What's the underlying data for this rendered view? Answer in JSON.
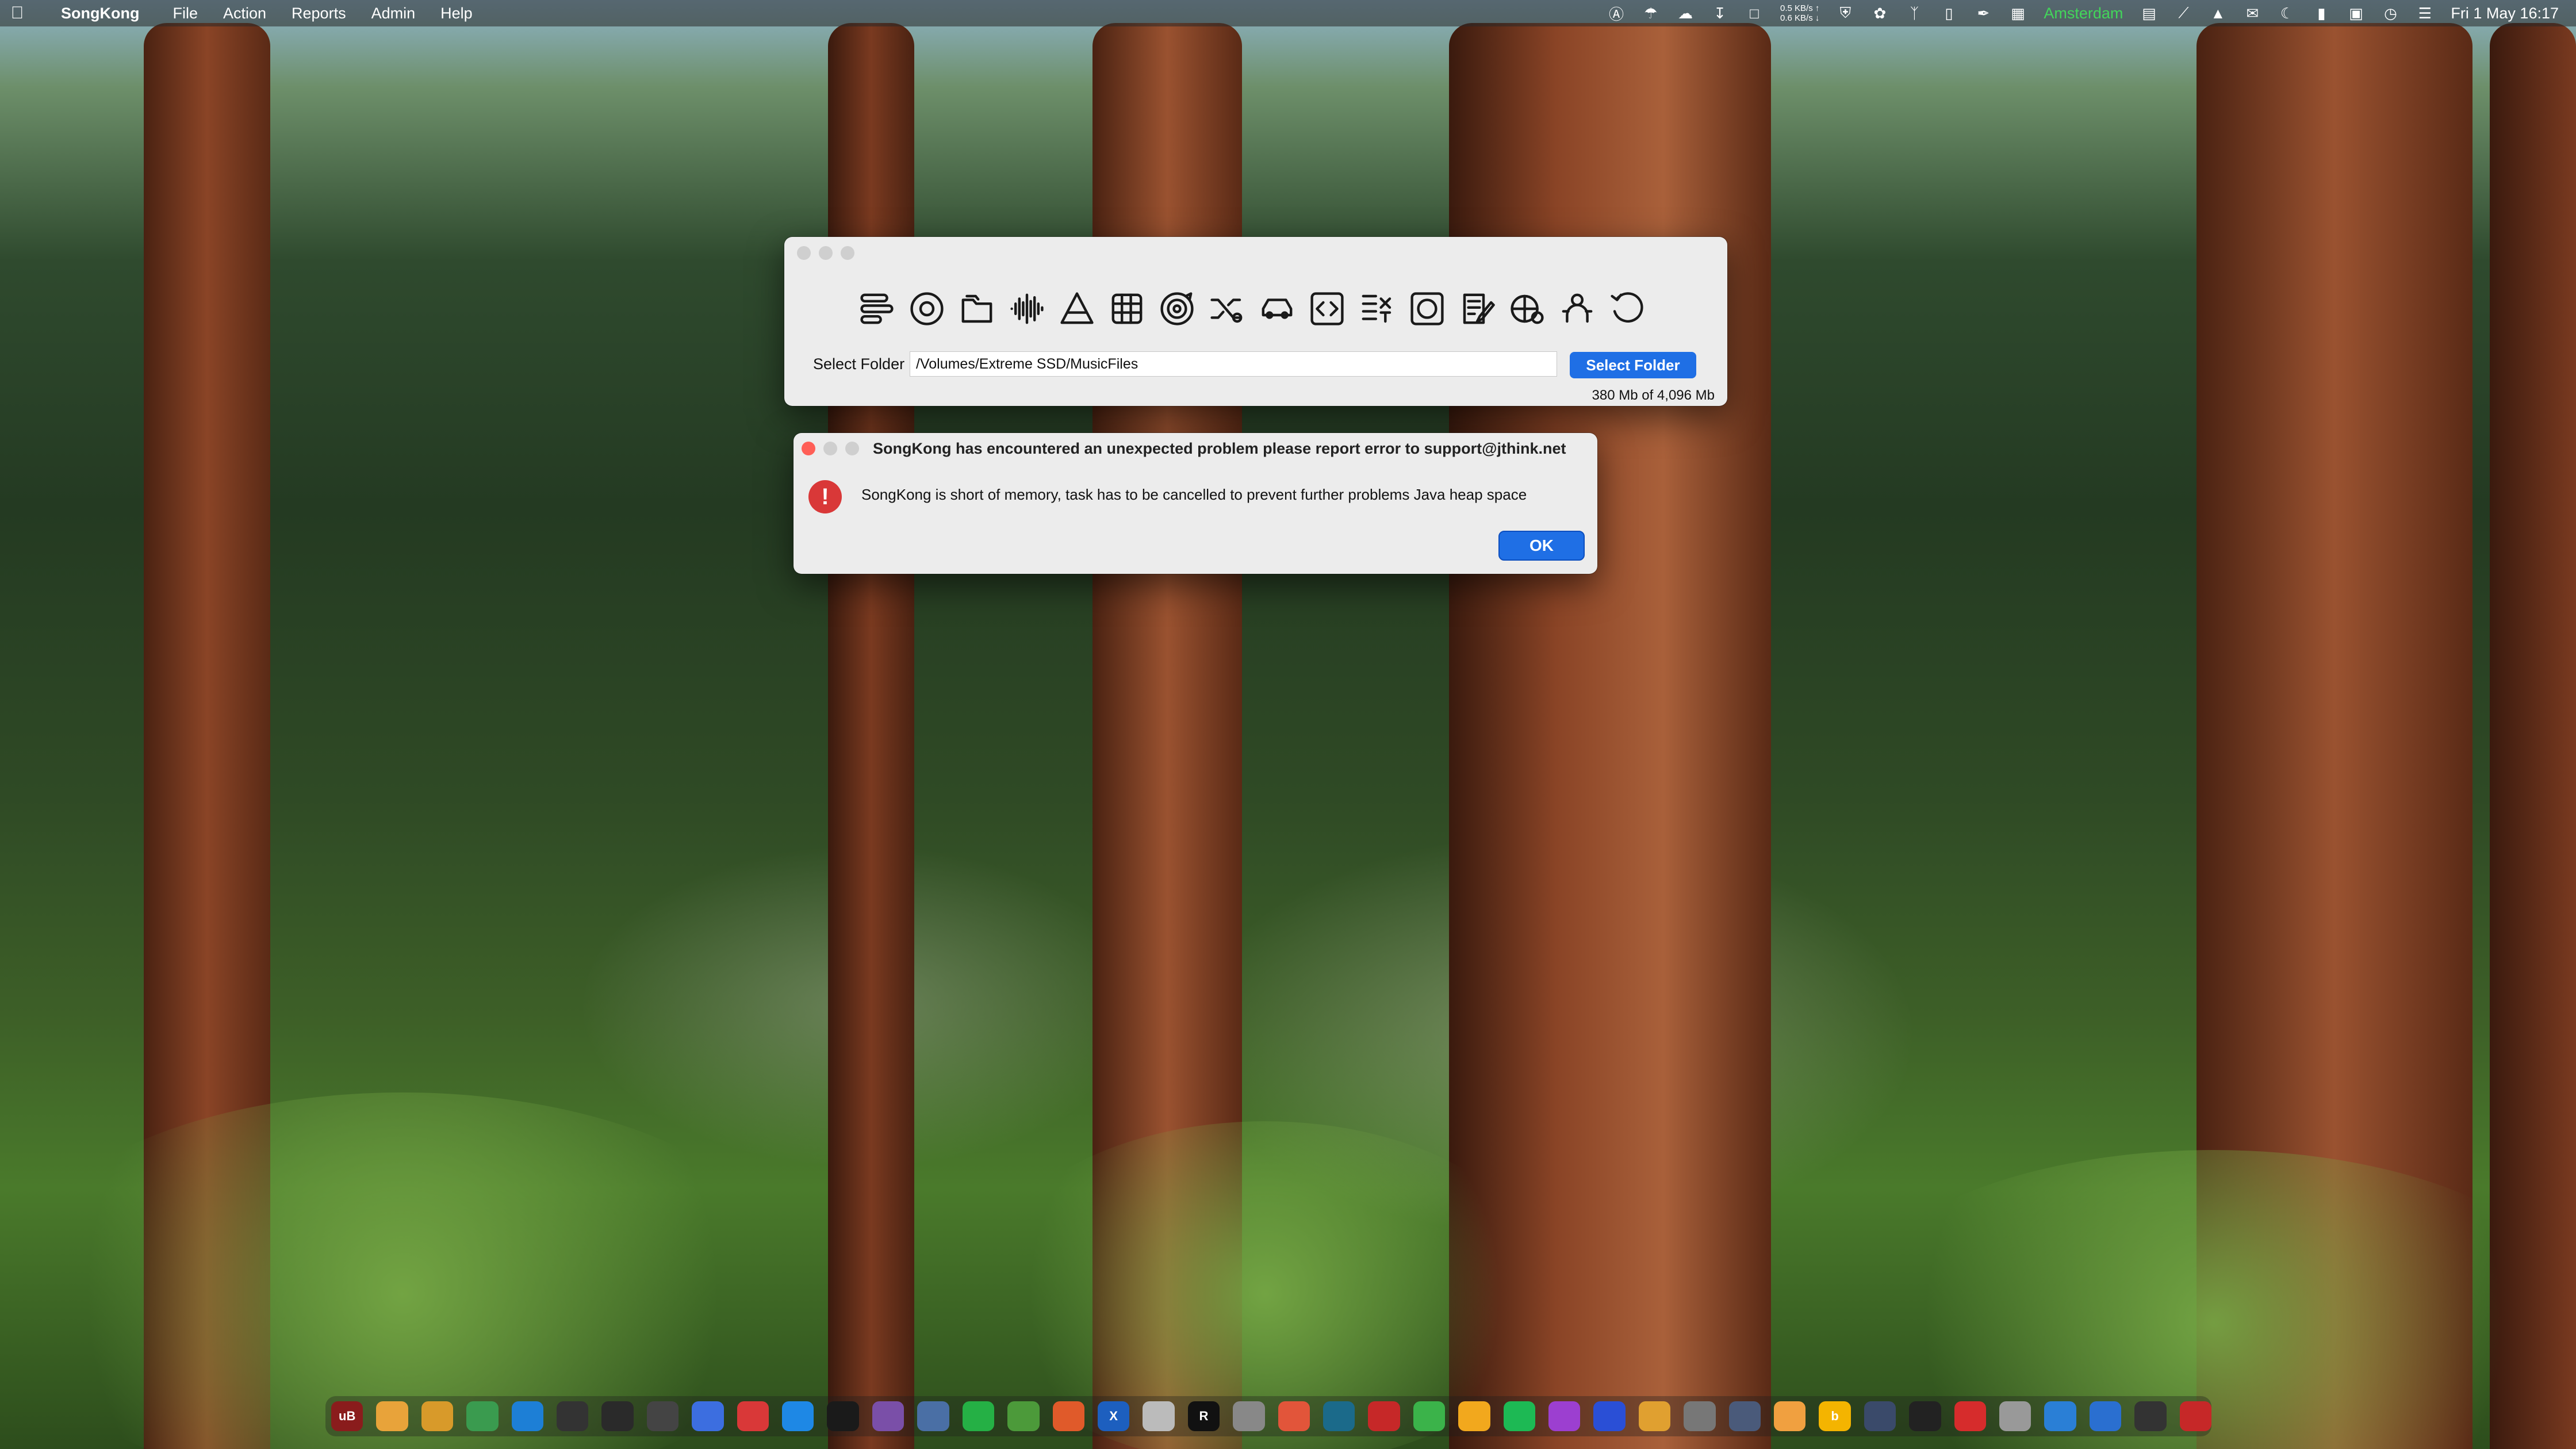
{
  "menubar": {
    "app_name": "SongKong",
    "menus": [
      "File",
      "Action",
      "Reports",
      "Admin",
      "Help"
    ],
    "net_up": "0.5 KB/s ↑",
    "net_down": "0.6 KB/s ↓",
    "location": "Amsterdam",
    "datetime": "Fri 1 May  16:17"
  },
  "main_window": {
    "toolbar_icons": [
      "status-icon",
      "match-icon",
      "folder-icon",
      "waveform-icon",
      "delete-duplicates-icon",
      "calendar-grid-icon",
      "rotate-target-icon",
      "shuffle-icon",
      "car-icon",
      "code-icon",
      "edit-list-icon",
      "disc-icon",
      "edit-note-icon",
      "globe-icon",
      "artist-icon",
      "undo-icon"
    ],
    "folder_label": "Select Folder",
    "folder_path": "/Volumes/Extreme SSD/MusicFiles",
    "select_button": "Select Folder",
    "memory": "380 Mb of 4,096 Mb"
  },
  "dialog": {
    "title": "SongKong has encountered an unexpected problem please report error to support@jthink.net",
    "message": "SongKong is short of memory, task has to be cancelled to prevent further problems Java heap space",
    "ok_label": "OK",
    "alert_glyph": "!"
  },
  "dock": {
    "items": [
      {
        "name": "ublock",
        "label": "uB",
        "color": "#8a1c1c"
      },
      {
        "name": "app-2",
        "label": "",
        "color": "#e8a33a"
      },
      {
        "name": "app-3",
        "label": "",
        "color": "#d89a2a"
      },
      {
        "name": "chrome",
        "label": "",
        "color": "#3a9b4f"
      },
      {
        "name": "app-5",
        "label": "",
        "color": "#1d7fd6"
      },
      {
        "name": "app-6",
        "label": "",
        "color": "#333333"
      },
      {
        "name": "app-7",
        "label": "",
        "color": "#2a2a2a"
      },
      {
        "name": "app-8",
        "label": "",
        "color": "#444444"
      },
      {
        "name": "app-9",
        "label": "",
        "color": "#3c6ee0"
      },
      {
        "name": "app-10",
        "label": "",
        "color": "#d93838"
      },
      {
        "name": "app-store",
        "label": "",
        "color": "#1e88e5"
      },
      {
        "name": "app-12",
        "label": "",
        "color": "#1a1a1a"
      },
      {
        "name": "app-13",
        "label": "",
        "color": "#7a4fa8"
      },
      {
        "name": "app-14",
        "label": "",
        "color": "#4a6fa5"
      },
      {
        "name": "whatsapp",
        "label": "",
        "color": "#25b045"
      },
      {
        "name": "app-16",
        "label": "",
        "color": "#4c9a3a"
      },
      {
        "name": "app-17",
        "label": "",
        "color": "#e05a2a"
      },
      {
        "name": "xcode",
        "label": "X",
        "color": "#1d5fbf"
      },
      {
        "name": "app-19",
        "label": "",
        "color": "#bbbbbb"
      },
      {
        "name": "app-20",
        "label": "R",
        "color": "#111111"
      },
      {
        "name": "app-21",
        "label": "",
        "color": "#888888"
      },
      {
        "name": "app-22",
        "label": "",
        "color": "#e2553a"
      },
      {
        "name": "app-23",
        "label": "",
        "color": "#1b6a8a"
      },
      {
        "name": "app-24",
        "label": "",
        "color": "#c62828"
      },
      {
        "name": "app-25",
        "label": "",
        "color": "#3bb34a"
      },
      {
        "name": "app-26",
        "label": "",
        "color": "#f2a81d"
      },
      {
        "name": "spotify",
        "label": "",
        "color": "#1db954"
      },
      {
        "name": "app-28",
        "label": "",
        "color": "#9c3fd0"
      },
      {
        "name": "app-29",
        "label": "",
        "color": "#2a4fd6"
      },
      {
        "name": "app-30",
        "label": "",
        "color": "#e0a030"
      },
      {
        "name": "app-31",
        "label": "",
        "color": "#777777"
      },
      {
        "name": "app-32",
        "label": "",
        "color": "#4a5a7a"
      },
      {
        "name": "app-33",
        "label": "",
        "color": "#f0a040"
      },
      {
        "name": "app-34",
        "label": "b",
        "color": "#f4b400"
      },
      {
        "name": "app-35",
        "label": "",
        "color": "#3a4a6a"
      },
      {
        "name": "app-36",
        "label": "",
        "color": "#222222"
      },
      {
        "name": "app-37",
        "label": "",
        "color": "#d62c2c"
      },
      {
        "name": "trash",
        "label": "",
        "color": "#999999"
      },
      {
        "name": "app-39",
        "label": "",
        "color": "#2a7fd6"
      },
      {
        "name": "app-40",
        "label": "",
        "color": "#2a6fd0"
      },
      {
        "name": "app-41",
        "label": "",
        "color": "#333333"
      },
      {
        "name": "app-42",
        "label": "",
        "color": "#c62828"
      }
    ]
  }
}
